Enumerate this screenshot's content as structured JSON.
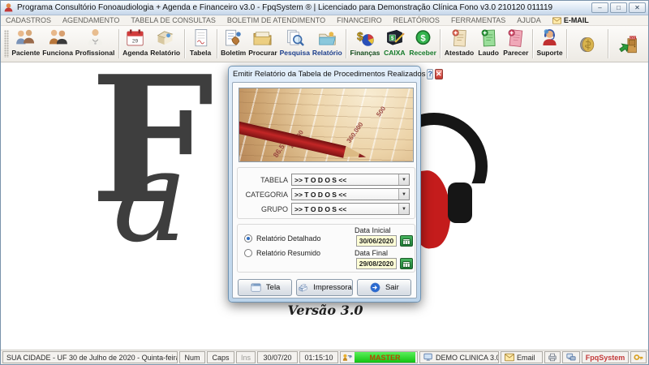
{
  "window": {
    "title": "Programa Consultório Fonoaudiologia + Agenda e Financeiro v3.0 - FpqSystem ® | Licenciado para  Demonstração Clínica Fono v3.0 210120 011119"
  },
  "icons": {
    "minimize": "–",
    "maximize": "□",
    "close": "✕",
    "help": "?",
    "dialog_close": "✕",
    "dropdown": "▼"
  },
  "menu": {
    "items": [
      "CADASTROS",
      "AGENDAMENTO",
      "TABELA DE CONSULTAS",
      "BOLETIM DE ATENDIMENTO",
      "FINANCEIRO",
      "RELATÓRIOS",
      "FERRAMENTAS",
      "AJUDA",
      "E-MAIL"
    ]
  },
  "toolbar": {
    "items": [
      "Paciente",
      "Funciona",
      "Profissional",
      "Agenda",
      "Relatório",
      "Tabela",
      "Boletim",
      "Procurar",
      "Pesquisa",
      "Relatório",
      "Finanças",
      "CAIXA",
      "Receber",
      "Atestado",
      "Laudo",
      "Parecer",
      "Suporte",
      "",
      ""
    ]
  },
  "background": {
    "logo_f": "F",
    "logo_a": "a",
    "version_text": "Versão 3.0"
  },
  "dialog": {
    "title": "Emitir Relatório da Tabela de Procedimentos Realizados",
    "image_numbers": [
      "500",
      "360.000",
      "26.300",
      "86.5"
    ],
    "filters": [
      {
        "label": "TABELA",
        "value": ">> T O D O S <<"
      },
      {
        "label": "CATEGORIA",
        "value": ">> T O D O S <<"
      },
      {
        "label": "GRUPO",
        "value": ">> T O D O S <<"
      }
    ],
    "radios": [
      {
        "label": "Relatório Detalhado",
        "selected": true
      },
      {
        "label": "Relatório Resumido",
        "selected": false
      }
    ],
    "dates": [
      {
        "label": "Data Inicial",
        "value": "30/06/2020"
      },
      {
        "label": "Data Final",
        "value": "29/08/2020"
      }
    ],
    "buttons": [
      {
        "label": "Tela"
      },
      {
        "label": "Impressora"
      },
      {
        "label": "Sair"
      }
    ]
  },
  "statusbar": {
    "location": "SUA CIDADE - UF 30 de Julho de 2020 - Quinta-feira",
    "num": "Num",
    "caps": "Caps",
    "ins": "Ins",
    "date": "30/07/20",
    "time": "01:15:10",
    "master": "MASTER",
    "clinic": "DEMO CLINICA 3.0",
    "email": "Email",
    "brand": "FpqSystem"
  },
  "colors": {
    "master_green": "#12c212",
    "brand_red": "#c33a3a",
    "date_field_bg": "#ffffd6",
    "calendar_green": "#1f7e38",
    "pencil_red": "#c22626"
  }
}
